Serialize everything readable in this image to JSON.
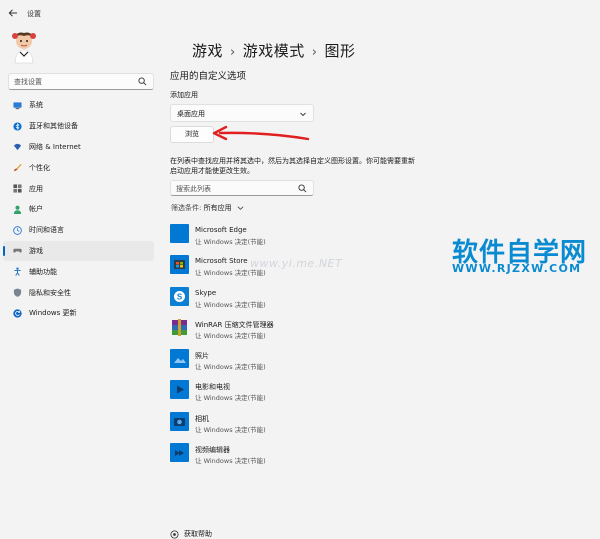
{
  "window": {
    "title": "设置"
  },
  "sidebar": {
    "search_placeholder": "查找设置",
    "items": [
      {
        "label": "系统",
        "icon": "monitor-icon",
        "active": false
      },
      {
        "label": "蓝牙和其他设备",
        "icon": "bluetooth-icon",
        "active": false
      },
      {
        "label": "网络 & Internet",
        "icon": "wifi-icon",
        "active": false
      },
      {
        "label": "个性化",
        "icon": "brush-icon",
        "active": false
      },
      {
        "label": "应用",
        "icon": "apps-icon",
        "active": false
      },
      {
        "label": "帐户",
        "icon": "person-icon",
        "active": false
      },
      {
        "label": "时间和语言",
        "icon": "globe-clock-icon",
        "active": false
      },
      {
        "label": "游戏",
        "icon": "gamepad-icon",
        "active": true
      },
      {
        "label": "辅助功能",
        "icon": "accessibility-icon",
        "active": false
      },
      {
        "label": "隐私和安全性",
        "icon": "shield-icon",
        "active": false
      },
      {
        "label": "Windows 更新",
        "icon": "update-icon",
        "active": false
      }
    ]
  },
  "breadcrumb": {
    "items": [
      "游戏",
      "游戏模式",
      "图形"
    ],
    "separator": "›"
  },
  "main": {
    "section_title": "应用的自定义选项",
    "add_app_label": "添加应用",
    "dropdown_value": "桌面应用",
    "browse_label": "浏览",
    "description": "在列表中查找应用并将其选中，然后为其选择自定义图形设置。你可能需要重新启动应用才能使更改生效。",
    "list_search_placeholder": "搜索此列表",
    "filter_label": "筛选条件:",
    "filter_value": "所有应用",
    "apps": [
      {
        "name": "Microsoft Edge",
        "sub": "让 Windows 决定(节能)",
        "icon": "edge-icon",
        "color": "#0078d4"
      },
      {
        "name": "Microsoft Store",
        "sub": "让 Windows 决定(节能)",
        "icon": "store-icon",
        "color": "#0078d4"
      },
      {
        "name": "Skype",
        "sub": "让 Windows 决定(节能)",
        "icon": "skype-icon",
        "color": "#0a7fd4"
      },
      {
        "name": "WinRAR 压缩文件管理器",
        "sub": "让 Windows 决定(节能)",
        "icon": "winrar-icon",
        "color": "#7a2b8c"
      },
      {
        "name": "照片",
        "sub": "让 Windows 决定(节能)",
        "icon": "photos-icon",
        "color": "#0078d4"
      },
      {
        "name": "电影和电视",
        "sub": "让 Windows 决定(节能)",
        "icon": "movies-icon",
        "color": "#0078d4"
      },
      {
        "name": "相机",
        "sub": "让 Windows 决定(节能)",
        "icon": "camera-icon",
        "color": "#0078d4"
      },
      {
        "name": "视频编辑器",
        "sub": "让 Windows 决定(节能)",
        "icon": "video-editor-icon",
        "color": "#0078d4"
      }
    ],
    "help_label": "获取帮助"
  },
  "watermark": {
    "main": "软件自学网",
    "url": "WWW.RJZXW.COM",
    "faint": "www.yi.me.NET"
  },
  "colors": {
    "accent": "#0067c0",
    "arrow": "#e02020",
    "watermark": "#0a8bd1"
  }
}
